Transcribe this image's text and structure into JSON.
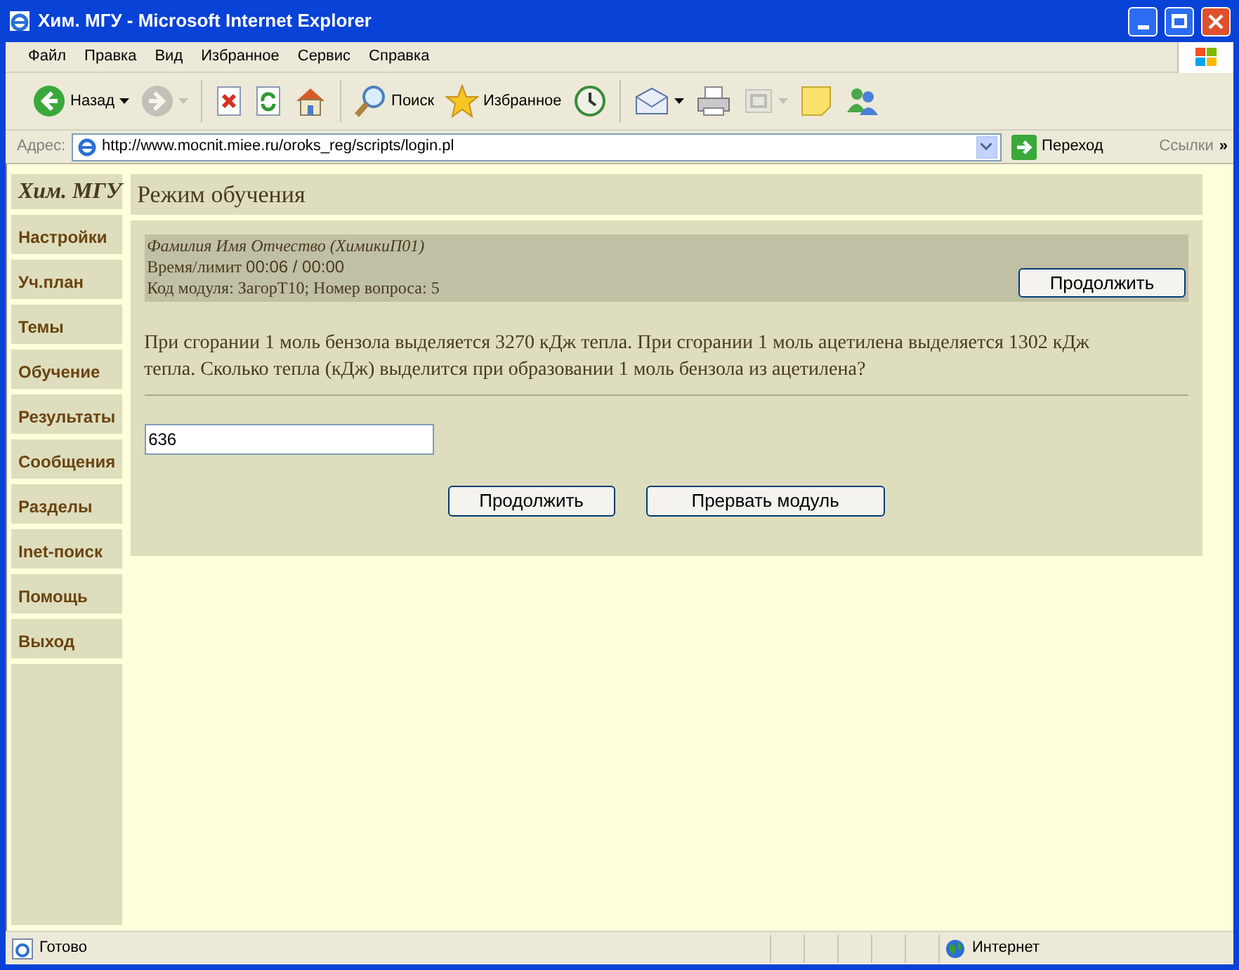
{
  "window": {
    "title": "Хим. МГУ - Microsoft Internet Explorer"
  },
  "menu": [
    "Файл",
    "Правка",
    "Вид",
    "Избранное",
    "Сервис",
    "Справка"
  ],
  "toolbar": [
    {
      "kind": "back",
      "label": "Назад",
      "dropdown": true,
      "disabled": false
    },
    {
      "kind": "forward",
      "dropdown": true,
      "disabled": true
    },
    {
      "kind": "stop",
      "disabled": false
    },
    {
      "kind": "refresh",
      "disabled": false
    },
    {
      "kind": "home",
      "disabled": false
    },
    {
      "kind": "search",
      "label": "Поиск",
      "disabled": false
    },
    {
      "kind": "favorites",
      "label": "Избранное",
      "disabled": false
    },
    {
      "kind": "history",
      "disabled": false
    },
    {
      "kind": "mail",
      "dropdown": true,
      "disabled": false
    },
    {
      "kind": "print",
      "disabled": false
    },
    {
      "kind": "edit",
      "dropdown": true,
      "disabled": true
    },
    {
      "kind": "note",
      "disabled": false
    },
    {
      "kind": "messenger",
      "disabled": false
    }
  ],
  "address_bar": {
    "label": "Адрес:",
    "url": "http://www.mocnit.miee.ru/oroks_reg/scripts/login.pl",
    "go": "Переход",
    "links": "Ссылки",
    "more": "»"
  },
  "sidebar": {
    "title": "Хим. МГУ",
    "items": [
      "Настройки",
      "Уч.план",
      "Темы",
      "Обучение",
      "Результаты",
      "Сообщения",
      "Разделы",
      "Inet-поиск",
      "Помощь",
      "Выход"
    ]
  },
  "page_title": "Режим обучения",
  "info": {
    "student": "Фамилия Имя Отчество (ХимикиП01)",
    "time_label": "Время/лимит",
    "time_value": "00:06 / 00:00",
    "module": "Код модуля: ЗагорТ10; Номер вопроса: 5",
    "button": "Продолжить"
  },
  "question": "При сгорании 1 моль бензола выделяется 3270 кДж тепла. При сгорании 1 моль ацетилена выделяется 1302 кДж тепла. Сколько тепла (кДж) выделится при образовании 1 моль бензола из ацетилена?",
  "answer": {
    "value": "636"
  },
  "buttons": [
    "Продолжить",
    "Прервать модуль"
  ],
  "status_bar": {
    "text": "Готово",
    "zone": "Интернет"
  }
}
